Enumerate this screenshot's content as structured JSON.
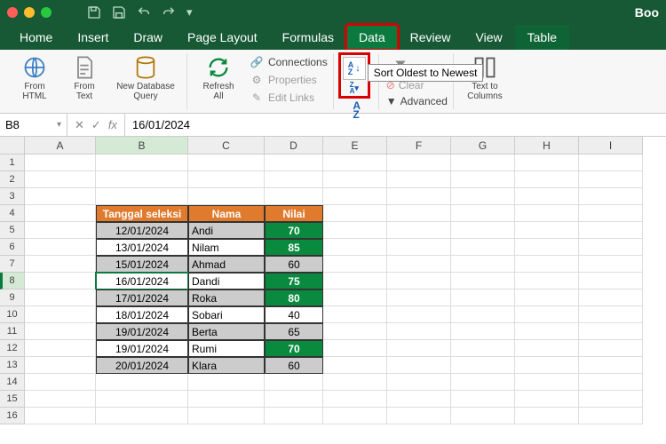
{
  "window": {
    "title": "Boo"
  },
  "tabs": [
    "Home",
    "Insert",
    "Draw",
    "Page Layout",
    "Formulas",
    "Data",
    "Review",
    "View",
    "Table"
  ],
  "active_tab": "Data",
  "ribbon": {
    "from_html": "From\nHTML",
    "from_text": "From\nText",
    "new_db_query": "New Database\nQuery",
    "refresh_all": "Refresh\nAll",
    "connections": "Connections",
    "properties": "Properties",
    "edit_links": "Edit Links",
    "sort_tooltip": "Sort Oldest to Newest",
    "clear": "Clear",
    "advanced": "Advanced",
    "text_to_columns": "Text to\nColumns"
  },
  "name_box": "B8",
  "formula": "16/01/2024",
  "columns": [
    "A",
    "B",
    "C",
    "D",
    "E",
    "F",
    "G",
    "H",
    "I"
  ],
  "table": {
    "headers": [
      "Tanggal seleksi",
      "Nama",
      "Nilai"
    ],
    "rows": [
      {
        "date": "12/01/2024",
        "name": "Andi",
        "val": "70",
        "shade": true,
        "green": true
      },
      {
        "date": "13/01/2024",
        "name": "Nilam",
        "val": "85",
        "shade": false,
        "green": true
      },
      {
        "date": "15/01/2024",
        "name": "Ahmad",
        "val": "60",
        "shade": true,
        "green": false
      },
      {
        "date": "16/01/2024",
        "name": "Dandi",
        "val": "75",
        "shade": false,
        "green": true
      },
      {
        "date": "17/01/2024",
        "name": "Roka",
        "val": "80",
        "shade": true,
        "green": true
      },
      {
        "date": "18/01/2024",
        "name": "Sobari",
        "val": "40",
        "shade": false,
        "green": false
      },
      {
        "date": "19/01/2024",
        "name": "Berta",
        "val": "65",
        "shade": true,
        "green": false
      },
      {
        "date": "19/01/2024",
        "name": "Rumi",
        "val": "70",
        "shade": false,
        "green": true
      },
      {
        "date": "20/01/2024",
        "name": "Klara",
        "val": "60",
        "shade": true,
        "green": false
      }
    ]
  },
  "selected_row": 8
}
